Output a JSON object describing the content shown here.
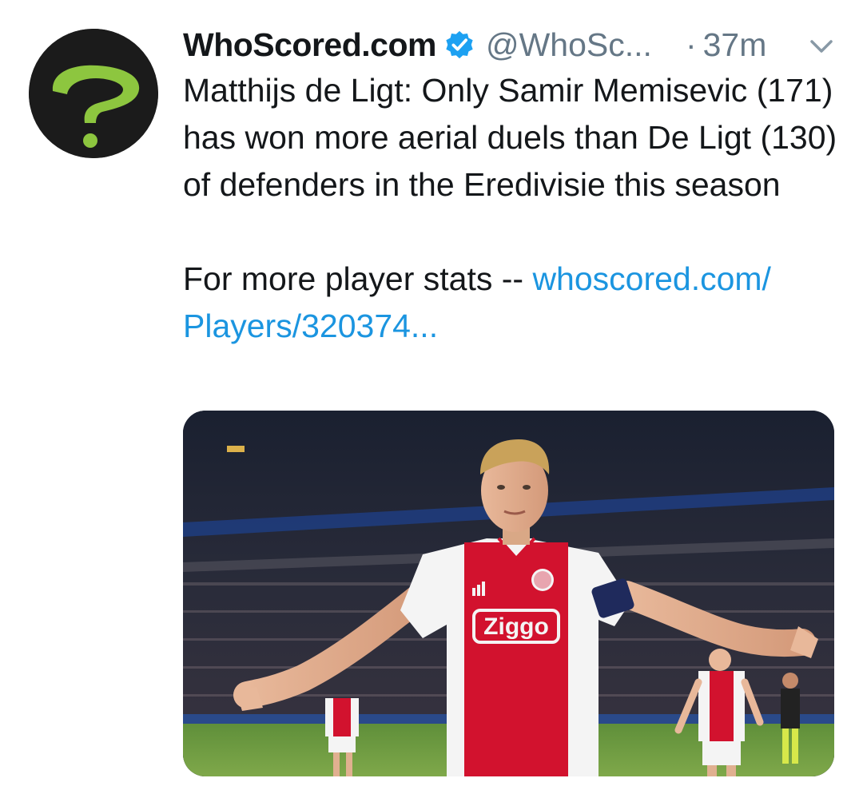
{
  "tweet": {
    "display_name": "WhoScored.com",
    "handle": "@WhoSc...",
    "separator": "·",
    "timestamp": "37m",
    "text_paragraph_1": "Matthijs de Ligt: Only Samir Memisevic (171) has won more aerial duels than De Ligt (130) of defenders in the Eredivisie this season",
    "text_paragraph_2_prefix": "For more player stats -- ",
    "link_text": "whoscored.com/ Players/320374...",
    "media": {
      "sponsor_text": "Ziggo"
    }
  },
  "icons": {
    "avatar": "question-mark-logo",
    "verified": "verified-badge-icon",
    "menu": "chevron-down-icon"
  },
  "colors": {
    "link": "#1b95e0",
    "secondary_text": "#657786",
    "verified_blue": "#1da1f2",
    "logo_green": "#8dc63f",
    "ajax_red": "#d2122e"
  }
}
